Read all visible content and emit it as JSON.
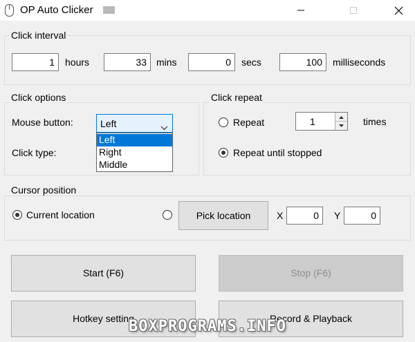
{
  "window": {
    "title": "OP Auto Clicker",
    "minimize_icon": "minimize-icon",
    "maximize_icon": "maximize-icon",
    "close_icon": "close-icon"
  },
  "click_interval": {
    "title": "Click interval",
    "hours": {
      "value": "1",
      "label": "hours"
    },
    "mins": {
      "value": "33",
      "label": "mins"
    },
    "secs": {
      "value": "0",
      "label": "secs"
    },
    "milliseconds": {
      "value": "100",
      "label": "milliseconds"
    }
  },
  "click_options": {
    "title": "Click options",
    "mouse_button_label": "Mouse button:",
    "mouse_button_value": "Left",
    "mouse_button_options": [
      "Left",
      "Right",
      "Middle"
    ],
    "click_type_label": "Click type:"
  },
  "click_repeat": {
    "title": "Click repeat",
    "repeat_label": "Repeat",
    "repeat_count": "1",
    "times_label": "times",
    "repeat_until_stopped_label": "Repeat until stopped",
    "selected": "repeat_until_stopped"
  },
  "cursor_position": {
    "title": "Cursor position",
    "current_location_label": "Current location",
    "pick_location_label": "Pick location",
    "x_label": "X",
    "x_value": "0",
    "y_label": "Y",
    "y_value": "0",
    "selected": "current_location"
  },
  "actions": {
    "start_label": "Start (F6)",
    "stop_label": "Stop (F6)",
    "hotkey_label": "Hotkey setting",
    "record_label": "Record & Playback"
  },
  "watermark": "BOXPROGRAMS.INFO",
  "colors": {
    "background": "#f0f0f0",
    "accent": "#0078d7",
    "disabled_button": "#cccccc"
  }
}
